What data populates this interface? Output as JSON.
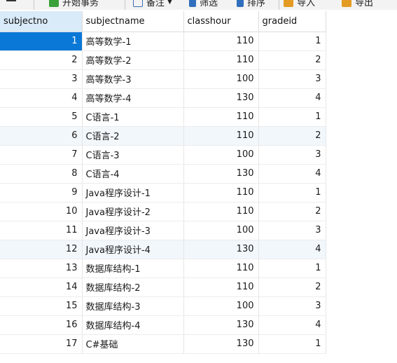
{
  "toolbar": {
    "begin_transaction": "开始事务",
    "note": "备注",
    "filter": "筛选",
    "sort": "排序",
    "import": "导入",
    "export": "导出"
  },
  "columns": [
    "subjectno",
    "subjectname",
    "classhour",
    "gradeid"
  ],
  "rows": [
    {
      "subjectno": "1",
      "subjectname": "高等数学-1",
      "classhour": "110",
      "gradeid": "1"
    },
    {
      "subjectno": "2",
      "subjectname": "高等数学-2",
      "classhour": "110",
      "gradeid": "2"
    },
    {
      "subjectno": "3",
      "subjectname": "高等数学-3",
      "classhour": "100",
      "gradeid": "3"
    },
    {
      "subjectno": "4",
      "subjectname": "高等数学-4",
      "classhour": "130",
      "gradeid": "4"
    },
    {
      "subjectno": "5",
      "subjectname": "C语言-1",
      "classhour": "110",
      "gradeid": "1"
    },
    {
      "subjectno": "6",
      "subjectname": "C语言-2",
      "classhour": "110",
      "gradeid": "2"
    },
    {
      "subjectno": "7",
      "subjectname": "C语言-3",
      "classhour": "100",
      "gradeid": "3"
    },
    {
      "subjectno": "8",
      "subjectname": "C语言-4",
      "classhour": "130",
      "gradeid": "4"
    },
    {
      "subjectno": "9",
      "subjectname": "Java程序设计-1",
      "classhour": "110",
      "gradeid": "1"
    },
    {
      "subjectno": "10",
      "subjectname": "Java程序设计-2",
      "classhour": "110",
      "gradeid": "2"
    },
    {
      "subjectno": "11",
      "subjectname": "Java程序设计-3",
      "classhour": "100",
      "gradeid": "3"
    },
    {
      "subjectno": "12",
      "subjectname": "Java程序设计-4",
      "classhour": "130",
      "gradeid": "4"
    },
    {
      "subjectno": "13",
      "subjectname": "数据库结构-1",
      "classhour": "110",
      "gradeid": "1"
    },
    {
      "subjectno": "14",
      "subjectname": "数据库结构-2",
      "classhour": "110",
      "gradeid": "2"
    },
    {
      "subjectno": "15",
      "subjectname": "数据库结构-3",
      "classhour": "100",
      "gradeid": "3"
    },
    {
      "subjectno": "16",
      "subjectname": "数据库结构-4",
      "classhour": "130",
      "gradeid": "4"
    },
    {
      "subjectno": "17",
      "subjectname": "C#基础",
      "classhour": "130",
      "gradeid": "1"
    }
  ],
  "colors": {
    "selection": "#0a78d7",
    "header_selected": "#d9ebf9",
    "alt_row": "#f2f7fc"
  }
}
